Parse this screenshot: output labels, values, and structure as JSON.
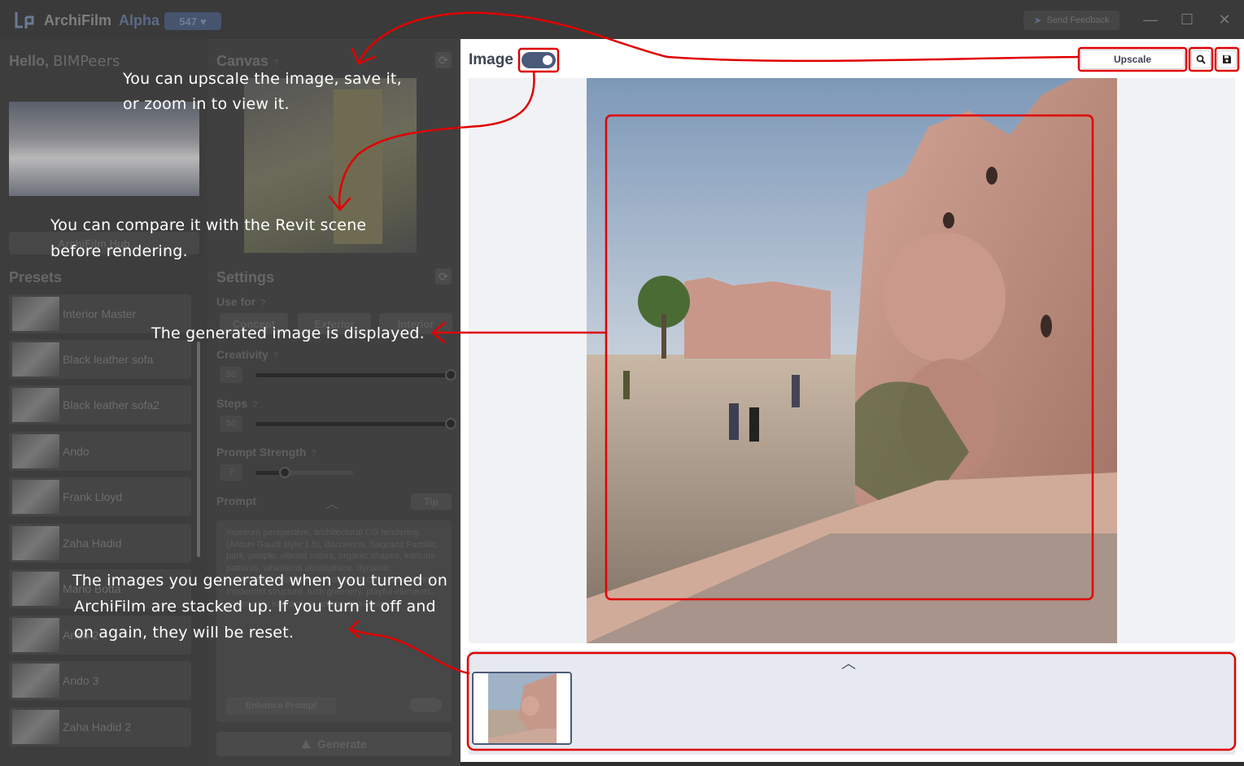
{
  "titlebar": {
    "app_name": "ArchiFilm",
    "app_tag": "Alpha",
    "credits": "547",
    "feedback_label": "Send Feedback"
  },
  "left": {
    "greeting": "Hello,",
    "username": "BIMPeers",
    "hub_label": "ArchiFilm Hub",
    "presets_title": "Presets",
    "presets": [
      "Interior Master",
      "Black leather sofa",
      "Black leather sofa2",
      "Ando",
      "Frank Lloyd",
      "Zaha Hadid",
      "Mario Botta",
      "Ando 2",
      "Ando 3",
      "Zaha Hadid 2"
    ]
  },
  "middle": {
    "canvas_title": "Canvas",
    "settings_title": "Settings",
    "use_for_label": "Use for",
    "use_for_options": [
      "Concept",
      "Exterior",
      "Interior"
    ],
    "creativity_label": "Creativity",
    "creativity_value": "50",
    "creativity": 1.0,
    "steps_label": "Steps",
    "steps_value": "50",
    "steps": 1.0,
    "prompt_strength_label": "Prompt Strength",
    "prompt_strength_value": "7",
    "prompt_strength": 0.3,
    "prompt_label": "Prompt",
    "tip_label": "Tip",
    "prompt_text": "museum perspective, architectural CG rendering, (Antoni Gaudi style:1.5), Barcelona, Sagrada Familia, park, people, vibrant colors, organic shapes, intricate patterns, whimsical atmosphere, dynamic composition, sunlight environment, cultural richness, modernist structure, lush greenery, playful elements, community interaction, artistic expression",
    "enhance_label": "Enhance Prompt",
    "generate_label": "Generate"
  },
  "main": {
    "image_label": "Image",
    "toggle_on": true,
    "upscale_label": "Upscale"
  },
  "annotations": {
    "upscale_note_1": "You can upscale the image, save it,",
    "upscale_note_2": "or zoom in to view it.",
    "compare_note_1": "You can compare it with the Revit scene",
    "compare_note_2": "before rendering.",
    "displayed_note": "The generated image is displayed.",
    "stack_note_1": "The images you generated when you turned on",
    "stack_note_2": "ArchiFilm are stacked up. If you turn it off and",
    "stack_note_3": "on again, they will be reset."
  },
  "colors": {
    "accent": "#4a5a7a",
    "annotation_red": "#e00000"
  }
}
